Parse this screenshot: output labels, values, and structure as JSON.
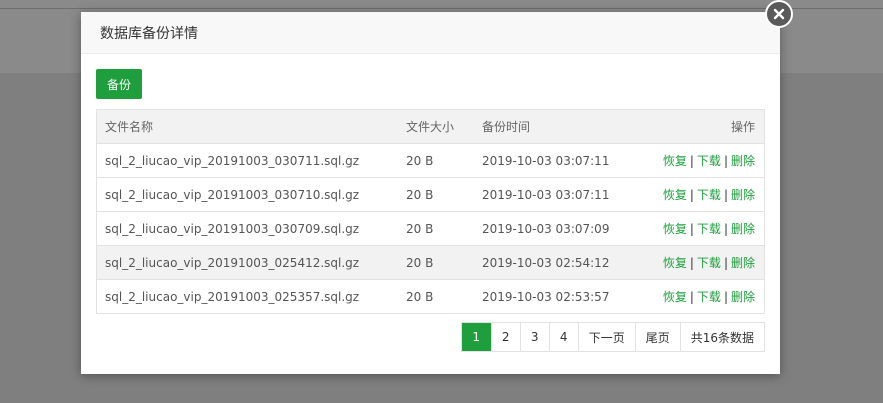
{
  "modal": {
    "title": "数据库备份详情",
    "backup_label": "备份"
  },
  "table": {
    "headers": {
      "name": "文件名称",
      "size": "文件大小",
      "time": "备份时间",
      "op": "操作"
    },
    "rows": [
      {
        "name": "sql_2_liucao_vip_20191003_030711.sql.gz",
        "size": "20 B",
        "time": "2019-10-03 03:07:11"
      },
      {
        "name": "sql_2_liucao_vip_20191003_030710.sql.gz",
        "size": "20 B",
        "time": "2019-10-03 03:07:11"
      },
      {
        "name": "sql_2_liucao_vip_20191003_030709.sql.gz",
        "size": "20 B",
        "time": "2019-10-03 03:07:09"
      },
      {
        "name": "sql_2_liucao_vip_20191003_025412.sql.gz",
        "size": "20 B",
        "time": "2019-10-03 02:54:12"
      },
      {
        "name": "sql_2_liucao_vip_20191003_025357.sql.gz",
        "size": "20 B",
        "time": "2019-10-03 02:53:57"
      }
    ],
    "actions": {
      "restore": "恢复",
      "download": "下载",
      "delete": "删除",
      "separator": "|"
    }
  },
  "pager": {
    "pages": [
      "1",
      "2",
      "3",
      "4"
    ],
    "current": "1",
    "next": "下一页",
    "last": "尾页",
    "total": "共16条数据"
  },
  "colors": {
    "accent": "#1e9e3c"
  }
}
